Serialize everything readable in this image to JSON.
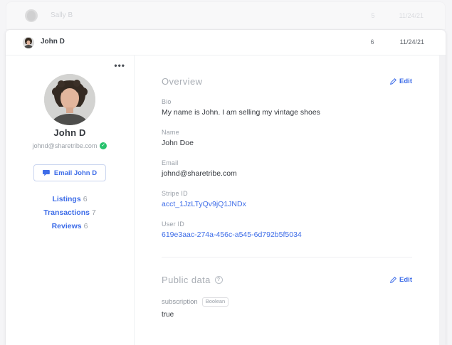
{
  "ghost_row": {
    "name": "Sally B",
    "count": "5",
    "date": "11/24/21"
  },
  "header": {
    "name": "John D",
    "count": "6",
    "date": "11/24/21"
  },
  "sidebar": {
    "menu_glyph": "•••",
    "name": "John D",
    "email": "johnd@sharetribe.com",
    "verified_glyph": "✓",
    "email_button_label": "Email John D",
    "links": [
      {
        "label": "Listings",
        "count": "6"
      },
      {
        "label": "Transactions",
        "count": "7"
      },
      {
        "label": "Reviews",
        "count": "6"
      }
    ]
  },
  "overview": {
    "title": "Overview",
    "edit_label": "Edit",
    "fields": [
      {
        "label": "Bio",
        "value": "My name is John. I am selling my vintage shoes"
      },
      {
        "label": "Name",
        "value": "John Doe"
      },
      {
        "label": "Email",
        "value": "johnd@sharetribe.com"
      },
      {
        "label": "Stripe ID",
        "value": "acct_1JzLTyQv9jQ1JNDx"
      },
      {
        "label": "User ID",
        "value": "619e3aac-274a-456c-a545-6d792b5f5034"
      }
    ]
  },
  "public_data": {
    "title": "Public data",
    "help_glyph": "?",
    "edit_label": "Edit",
    "fields": [
      {
        "key": "subscription",
        "type_badge": "Boolean",
        "value": "true"
      }
    ]
  },
  "colors": {
    "accent_blue": "#3e6de8",
    "verified_green": "#27c26c",
    "page_bg": "#f5f5f7",
    "card_bg": "#ffffff",
    "muted_text": "#9aa0a8"
  }
}
